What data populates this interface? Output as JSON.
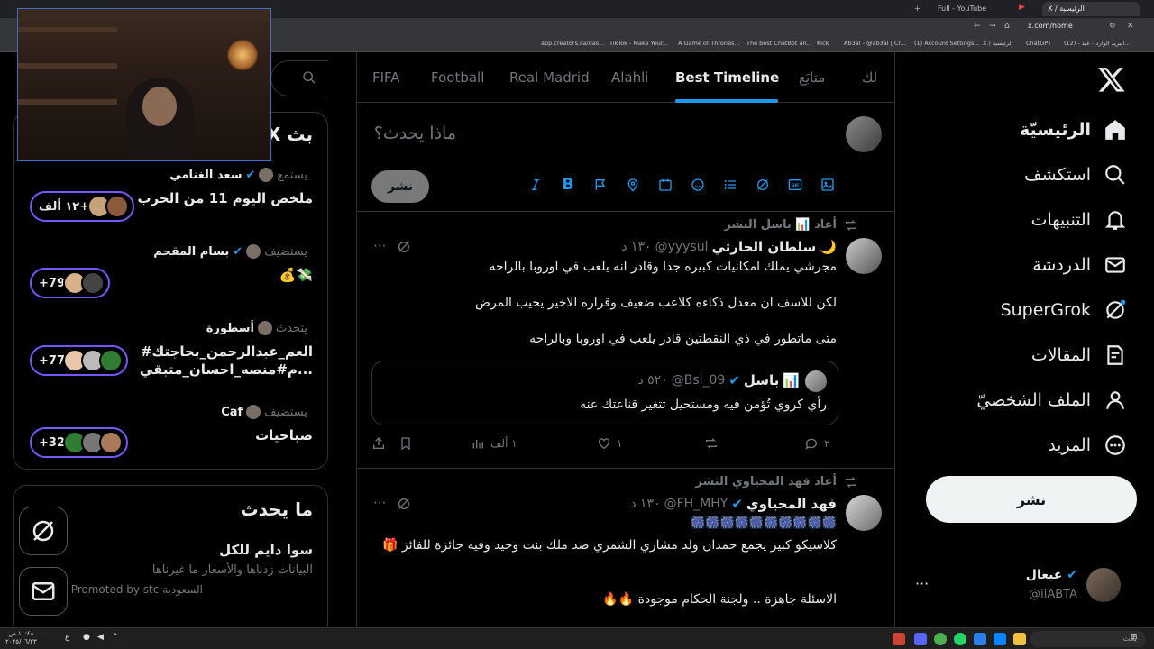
{
  "browser": {
    "tabs": [
      {
        "label": "+",
        "active": false
      },
      {
        "label": "Full - YouTube",
        "active": false
      },
      {
        "label": "X / الرئيسية",
        "active": true
      }
    ],
    "url": "x.com/home",
    "bookmarks": [
      "app.creators.sa/das...",
      "TikTok - Make Your...",
      "A Game of Thrones...",
      "The best ChatBot an...",
      "Kick",
      "Ab3al - @ab3al | Cr...",
      "(1) Account Settings...",
      "X / الرئيسية",
      "ChatGPT",
      "(12) - البريد الوارد - عبد..."
    ]
  },
  "nav": {
    "items": [
      {
        "label": "الرئيسيّة",
        "icon": "home-icon",
        "active": true
      },
      {
        "label": "استكشف",
        "icon": "search-icon",
        "active": false
      },
      {
        "label": "التنبيهات",
        "icon": "bell-icon",
        "active": false
      },
      {
        "label": "الدردشة",
        "icon": "mail-icon",
        "active": false
      },
      {
        "label": "SuperGrok",
        "icon": "grok-icon",
        "active": false
      },
      {
        "label": "المقالات",
        "icon": "article-icon",
        "active": false
      },
      {
        "label": "الملف الشخصيّ",
        "icon": "profile-icon",
        "active": false
      },
      {
        "label": "المزيد",
        "icon": "more-icon",
        "active": false
      }
    ],
    "post_label": "نشر",
    "account": {
      "name": "عبعال",
      "handle": "@iiABTA",
      "more": "···"
    }
  },
  "main": {
    "tabs": [
      {
        "label": "لك"
      },
      {
        "label": "متابَع"
      },
      {
        "label": "Best Timeline",
        "active": true
      },
      {
        "label": "Alahli"
      },
      {
        "label": "Real Madrid"
      },
      {
        "label": "Football"
      },
      {
        "label": "FIFA"
      }
    ],
    "compose": {
      "placeholder": "ماذا يحدث؟",
      "post_label": "نشر"
    },
    "tweets": [
      {
        "retweet_by": "أعاد 📊 باسل النشر",
        "name": "سلطان الحارثي",
        "name_prefix": "🌙",
        "handle": "@yyysul",
        "time": "١٣٠ د",
        "lines": [
          "مجرشي يملك امكانيات كبيره جدا وقادر انه يلعب في اوروبا بالراحه",
          "لكن للاسف ان معدل ذكاءه كلاعب ضعيف وقراره الاخير يجيب المرض",
          "متى ماتطور في ذي النقطتين قادر يلعب في اوروبا وبالراحه"
        ],
        "quote": {
          "name": "باسل",
          "name_prefix": "📊",
          "handle": "@Bsl_09",
          "time": "٥٢٠ د",
          "text": "رأي كروي تُؤمن فيه ومستحيل تتغير قناعتك عنه"
        },
        "replies": "٢",
        "retweets": "",
        "likes": "١",
        "views": "١ ألف"
      },
      {
        "retweet_by": "أعاد فهد المحياوي النشر",
        "name": "فهد المحياوي",
        "handle": "@FH_MHY",
        "time": "١٣٠ د",
        "lines": [
          "🎆🎆🎆🎆🎆🎆🎆🎆🎆🎆",
          "كلاسيكو كبير يجمع حمدان ولد مشاري الشمري ضد ملك بنت وحيد وفيه جائزة للفائز 🎁",
          "الاسئلة جاهزة .. ولجنة الحكام موجودة 🔥🔥"
        ]
      }
    ]
  },
  "right": {
    "search_icon": "search-icon",
    "spaces_title": "X بث",
    "spaces": [
      {
        "role": "يستمع",
        "host": "سعد الغنامي",
        "topic": "ملخص اليوم 11 من الحرب",
        "count": "١٢ ألف+"
      },
      {
        "role": "يستضيف",
        "host": "بسام المقحم",
        "topic": "💸💰",
        "count": "+79"
      },
      {
        "role": "يتحدث",
        "host": "أسطورة",
        "topic": "العم_عبدالرحمن_بحاجتك#",
        "topic2": "...م#منصه_احسان_متبقي",
        "count": "+77"
      },
      {
        "role": "يستضيف",
        "host": "Caf",
        "topic": "صباحيات",
        "count": "+32"
      }
    ],
    "happening": {
      "title": "ما يحدث",
      "trend": "سوا دايم للكل",
      "desc": "البيانات زدناها والأسعار ما غيرناها",
      "promo": "Promoted by stc السعودية"
    }
  },
  "taskbar": {
    "search": "بحث",
    "clock_time": "١٠:٤٨ ص",
    "clock_date": "٢٠٢٥/٠٦/٢٣"
  },
  "colors": {
    "accent": "#1d9bf0",
    "spaces": "#7856ff",
    "verified": "#1d9bf0"
  }
}
